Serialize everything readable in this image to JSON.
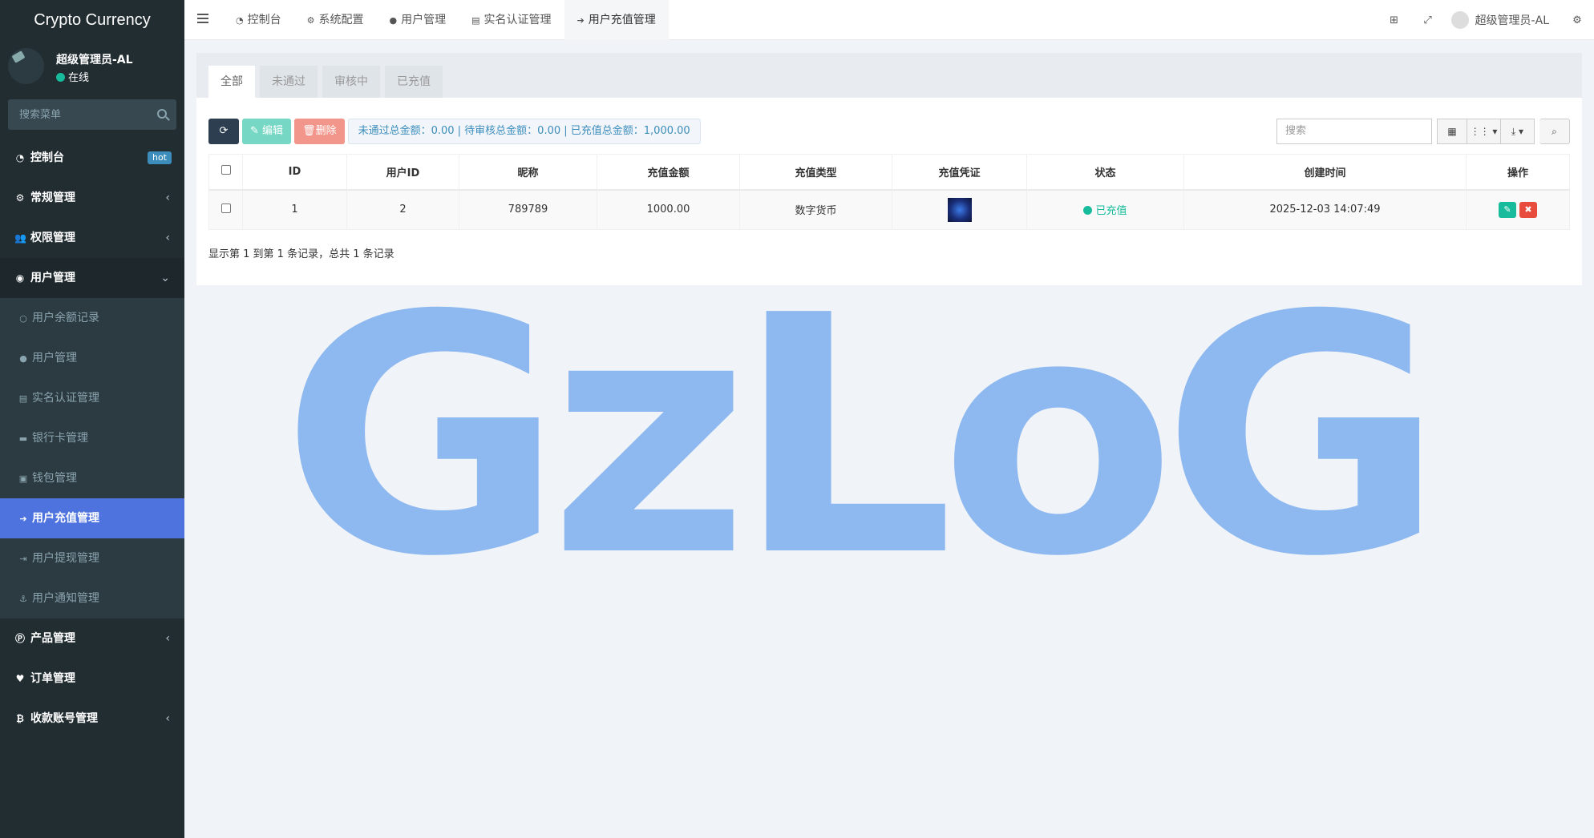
{
  "app": {
    "title": "Crypto Currency"
  },
  "user": {
    "name": "超级管理员-AL",
    "status": "在线"
  },
  "sidebar": {
    "search_placeholder": "搜索菜单",
    "items": [
      {
        "label": "控制台",
        "icon": "dashboard-icon",
        "badge": "hot"
      },
      {
        "label": "常规管理",
        "icon": "cogs-icon"
      },
      {
        "label": "权限管理",
        "icon": "group-icon"
      },
      {
        "label": "用户管理",
        "icon": "user-circle-icon"
      },
      {
        "label": "产品管理",
        "icon": "product-icon"
      },
      {
        "label": "订单管理",
        "icon": "heartbeat-icon"
      },
      {
        "label": "收款账号管理",
        "icon": "bitcoin-icon"
      }
    ],
    "sub_items": [
      {
        "label": "用户余额记录",
        "icon": "circle-icon"
      },
      {
        "label": "用户管理",
        "icon": "user-icon"
      },
      {
        "label": "实名认证管理",
        "icon": "id-card-icon"
      },
      {
        "label": "银行卡管理",
        "icon": "credit-card-icon"
      },
      {
        "label": "钱包管理",
        "icon": "money-icon"
      },
      {
        "label": "用户充值管理",
        "icon": "sign-in-icon"
      },
      {
        "label": "用户提现管理",
        "icon": "sign-out-icon"
      },
      {
        "label": "用户通知管理",
        "icon": "anchor-icon"
      }
    ]
  },
  "topnav": {
    "tabs": [
      {
        "label": "控制台",
        "icon": "dashboard-icon"
      },
      {
        "label": "系统配置",
        "icon": "cog-icon"
      },
      {
        "label": "用户管理",
        "icon": "user-icon"
      },
      {
        "label": "实名认证管理",
        "icon": "id-card-icon"
      },
      {
        "label": "用户充值管理",
        "icon": "sign-in-icon"
      }
    ],
    "user_label": "超级管理员-AL"
  },
  "main": {
    "filter_tabs": [
      "全部",
      "未通过",
      "审核中",
      "已充值"
    ],
    "buttons": {
      "edit": "编辑",
      "delete": "删除"
    },
    "summary": "未通过总金额：0.00 | 待审核总金额：0.00 | 已充值总金额：1,000.00",
    "search_placeholder": "搜索",
    "columns": [
      "ID",
      "用户ID",
      "昵称",
      "充值金额",
      "充值类型",
      "充值凭证",
      "状态",
      "创建时间",
      "操作"
    ],
    "rows": [
      {
        "id": "1",
        "user_id": "2",
        "nickname": "789789",
        "amount": "1000.00",
        "type": "数字货币",
        "status": "已充值",
        "created": "2025-12-03 14:07:49"
      }
    ],
    "page_info": "显示第 1 到第 1 条记录，总共 1 条记录"
  },
  "watermark": "GzLoG",
  "colors": {
    "sidebar": "#222d32",
    "active": "#4e73df",
    "success": "#18bc9c",
    "danger": "#e74c3c",
    "watermark": "#8db8f0"
  }
}
